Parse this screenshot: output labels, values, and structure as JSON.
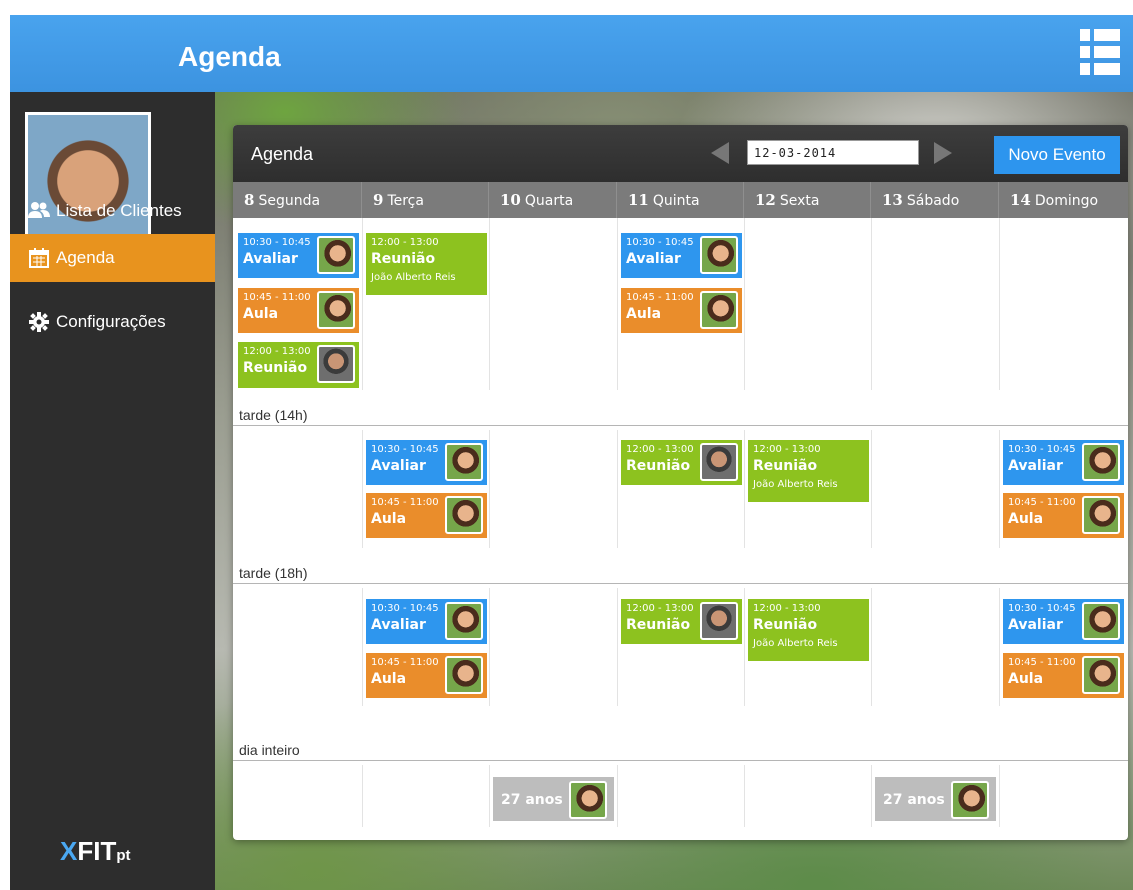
{
  "header": {
    "title": "Agenda"
  },
  "sidebar": {
    "items": [
      {
        "label": "Lista de Clientes",
        "icon": "users-icon"
      },
      {
        "label": "Agenda",
        "icon": "calendar-icon",
        "active": true
      },
      {
        "label": "Configurações",
        "icon": "gear-icon"
      }
    ],
    "logo": {
      "x": "X",
      "fit": "FIT",
      "pt": "pt"
    }
  },
  "panel": {
    "title": "Agenda",
    "date_value": "12-03-2014",
    "new_event_label": "Novo Evento"
  },
  "days": [
    {
      "num": "8",
      "name": "Segunda"
    },
    {
      "num": "9",
      "name": "Terça"
    },
    {
      "num": "10",
      "name": "Quarta"
    },
    {
      "num": "11",
      "name": "Quinta"
    },
    {
      "num": "12",
      "name": "Sexta"
    },
    {
      "num": "13",
      "name": "Sábado"
    },
    {
      "num": "14",
      "name": "Domingo"
    }
  ],
  "sections": [
    "tarde (14h)",
    "tarde (18h)",
    "dia inteiro"
  ],
  "events": {
    "avaliar": {
      "time": "10:30 - 10:45",
      "title": "Avaliar"
    },
    "aula": {
      "time": "10:45 - 11:00",
      "title": "Aula"
    },
    "reuniao": {
      "time": "12:00 - 13:00",
      "title": "Reunião",
      "sub": "João Alberto Reis"
    },
    "birthday": "27 anos"
  },
  "colors": {
    "accent": "#e8931e",
    "header": "#49a3ee",
    "blue": "#2e96ee",
    "orange": "#ea8d2b",
    "green": "#8dc21f"
  }
}
